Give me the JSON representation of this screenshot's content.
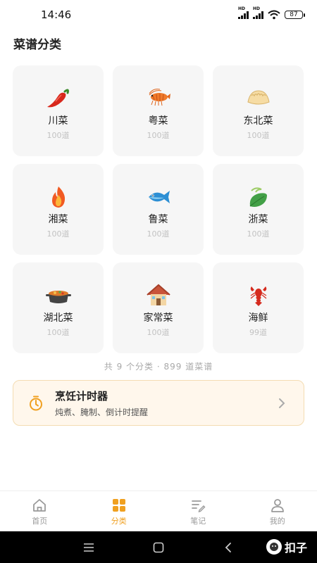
{
  "status_bar": {
    "time": "14:46",
    "battery": "87",
    "hd": "HD"
  },
  "page_title": "菜谱分类",
  "categories": [
    {
      "name": "川菜",
      "count": "100道",
      "icon": "chili-icon"
    },
    {
      "name": "粤菜",
      "count": "100道",
      "icon": "shrimp-icon"
    },
    {
      "name": "东北菜",
      "count": "100道",
      "icon": "dumpling-icon"
    },
    {
      "name": "湘菜",
      "count": "100道",
      "icon": "fire-icon"
    },
    {
      "name": "鲁菜",
      "count": "100道",
      "icon": "fish-icon"
    },
    {
      "name": "浙菜",
      "count": "100道",
      "icon": "leaf-icon"
    },
    {
      "name": "湖北菜",
      "count": "100道",
      "icon": "pot-icon"
    },
    {
      "name": "家常菜",
      "count": "100道",
      "icon": "house-icon"
    },
    {
      "name": "海鲜",
      "count": "99道",
      "icon": "lobster-icon"
    }
  ],
  "summary": "共 9 个分类 · 899 道菜谱",
  "timer": {
    "title": "烹饪计时器",
    "subtitle": "炖煮、腌制、倒计时提醒"
  },
  "tabs": [
    {
      "label": "首页",
      "icon": "home-icon",
      "active": false
    },
    {
      "label": "分类",
      "icon": "grid-icon",
      "active": true
    },
    {
      "label": "笔记",
      "icon": "note-icon",
      "active": false
    },
    {
      "label": "我的",
      "icon": "user-icon",
      "active": false
    }
  ],
  "watermark": "扣子",
  "colors": {
    "accent": "#f0a020",
    "card_bg": "#f6f6f6",
    "timer_bg": "#fff7ec"
  }
}
